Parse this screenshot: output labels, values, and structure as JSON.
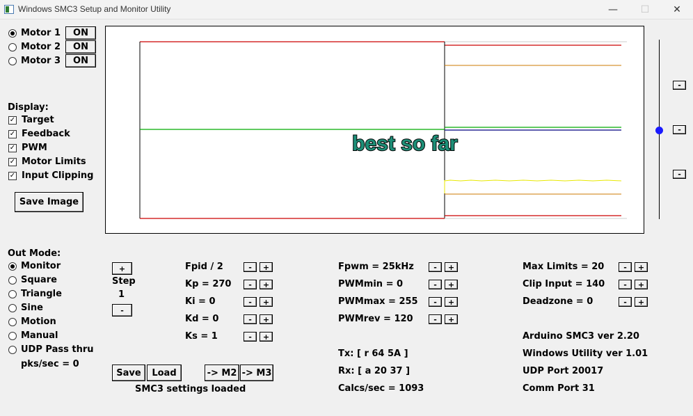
{
  "window": {
    "title": "Windows SMC3 Setup and Monitor Utility",
    "minimize_glyph": "—",
    "maximize_glyph": "☐",
    "close_glyph": "✕"
  },
  "motors": [
    {
      "label": "Motor 1",
      "button": "ON",
      "selected": true
    },
    {
      "label": "Motor 2",
      "button": "ON",
      "selected": false
    },
    {
      "label": "Motor 3",
      "button": "ON",
      "selected": false
    }
  ],
  "display": {
    "heading": "Display:",
    "options": [
      {
        "label": "Target",
        "checked": true
      },
      {
        "label": "Feedback",
        "checked": true
      },
      {
        "label": "PWM",
        "checked": true
      },
      {
        "label": "Motor Limits",
        "checked": true
      },
      {
        "label": "Input Clipping",
        "checked": true
      }
    ],
    "save_image": "Save Image"
  },
  "out_mode": {
    "heading": "Out Mode:",
    "options": [
      {
        "label": "Monitor",
        "selected": true
      },
      {
        "label": "Square",
        "selected": false
      },
      {
        "label": "Triangle",
        "selected": false
      },
      {
        "label": "Sine",
        "selected": false
      },
      {
        "label": "Motion",
        "selected": false
      },
      {
        "label": "Manual",
        "selected": false
      },
      {
        "label": "UDP Pass thru",
        "selected": false
      }
    ],
    "pks_sec": "pks/sec = 0"
  },
  "step": {
    "plus": "+",
    "label": "Step",
    "value": "1",
    "minus": "-"
  },
  "pid": [
    {
      "label": "Fpid / 2"
    },
    {
      "label": "Kp = 270"
    },
    {
      "label": "Ki = 0"
    },
    {
      "label": "Kd = 0"
    },
    {
      "label": "Ks = 1"
    }
  ],
  "pwm": [
    {
      "label": "Fpwm = 25kHz"
    },
    {
      "label": "PWMmin = 0"
    },
    {
      "label": "PWMmax = 255"
    },
    {
      "label": "PWMrev = 120"
    }
  ],
  "limits": [
    {
      "label": "Max Limits = 20"
    },
    {
      "label": "Clip Input = 140"
    },
    {
      "label": "Deadzone = 0"
    }
  ],
  "stepper_labels": {
    "minus": "-",
    "plus": "+"
  },
  "comm": {
    "tx": "Tx: [ r 64 5A ]",
    "rx": "Rx: [ a 20 37 ]",
    "calcs": "Calcs/sec = 1093"
  },
  "info": {
    "arduino": "Arduino SMC3 ver 2.20",
    "utility": "Windows Utility ver 1.01",
    "udp": "UDP Port 20017",
    "comm_port": "Comm Port 31"
  },
  "actions": {
    "save": "Save",
    "load": "Load",
    "to_m2": "-> M2",
    "to_m3": "-> M3",
    "status": "SMC3 settings loaded"
  },
  "slider_buttons": {
    "top": "-",
    "mid": "-",
    "bottom": "-"
  },
  "plot": {
    "overlay_text": "best so far",
    "colors": {
      "limits": "#cc0000",
      "target": "#00aa00",
      "feedback": "#000080",
      "pwm": "#e8e800",
      "clip": "#cc7a00",
      "overlay": "#1e8f78"
    }
  }
}
